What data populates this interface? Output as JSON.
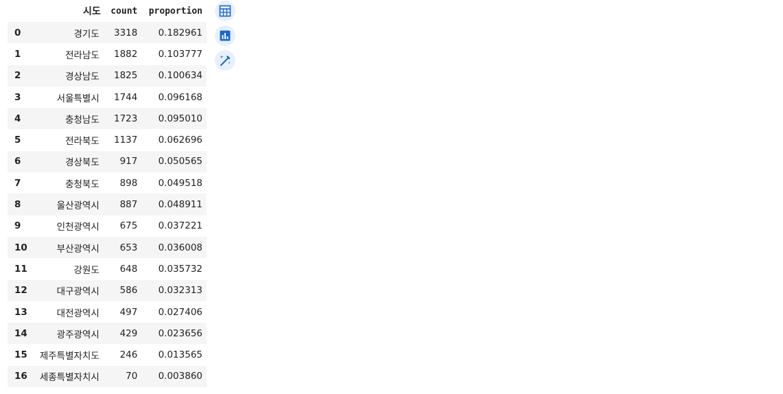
{
  "table": {
    "columns": {
      "sido": "시도",
      "count": "count",
      "proportion": "proportion"
    },
    "rows": [
      {
        "index": "0",
        "sido": "경기도",
        "count": "3318",
        "proportion": "0.182961"
      },
      {
        "index": "1",
        "sido": "전라남도",
        "count": "1882",
        "proportion": "0.103777"
      },
      {
        "index": "2",
        "sido": "경상남도",
        "count": "1825",
        "proportion": "0.100634"
      },
      {
        "index": "3",
        "sido": "서울특별시",
        "count": "1744",
        "proportion": "0.096168"
      },
      {
        "index": "4",
        "sido": "충청남도",
        "count": "1723",
        "proportion": "0.095010"
      },
      {
        "index": "5",
        "sido": "전라북도",
        "count": "1137",
        "proportion": "0.062696"
      },
      {
        "index": "6",
        "sido": "경상북도",
        "count": "917",
        "proportion": "0.050565"
      },
      {
        "index": "7",
        "sido": "충청북도",
        "count": "898",
        "proportion": "0.049518"
      },
      {
        "index": "8",
        "sido": "울산광역시",
        "count": "887",
        "proportion": "0.048911"
      },
      {
        "index": "9",
        "sido": "인천광역시",
        "count": "675",
        "proportion": "0.037221"
      },
      {
        "index": "10",
        "sido": "부산광역시",
        "count": "653",
        "proportion": "0.036008"
      },
      {
        "index": "11",
        "sido": "강원도",
        "count": "648",
        "proportion": "0.035732"
      },
      {
        "index": "12",
        "sido": "대구광역시",
        "count": "586",
        "proportion": "0.032313"
      },
      {
        "index": "13",
        "sido": "대전광역시",
        "count": "497",
        "proportion": "0.027406"
      },
      {
        "index": "14",
        "sido": "광주광역시",
        "count": "429",
        "proportion": "0.023656"
      },
      {
        "index": "15",
        "sido": "제주특별자치도",
        "count": "246",
        "proportion": "0.013565"
      },
      {
        "index": "16",
        "sido": "세종특별자치시",
        "count": "70",
        "proportion": "0.003860"
      }
    ]
  },
  "toolbar": {
    "icons": [
      "table-icon",
      "bar-chart-icon",
      "magic-wand-icon"
    ],
    "accent_color": "#1967d2",
    "button_bg": "#e8f0fe"
  }
}
